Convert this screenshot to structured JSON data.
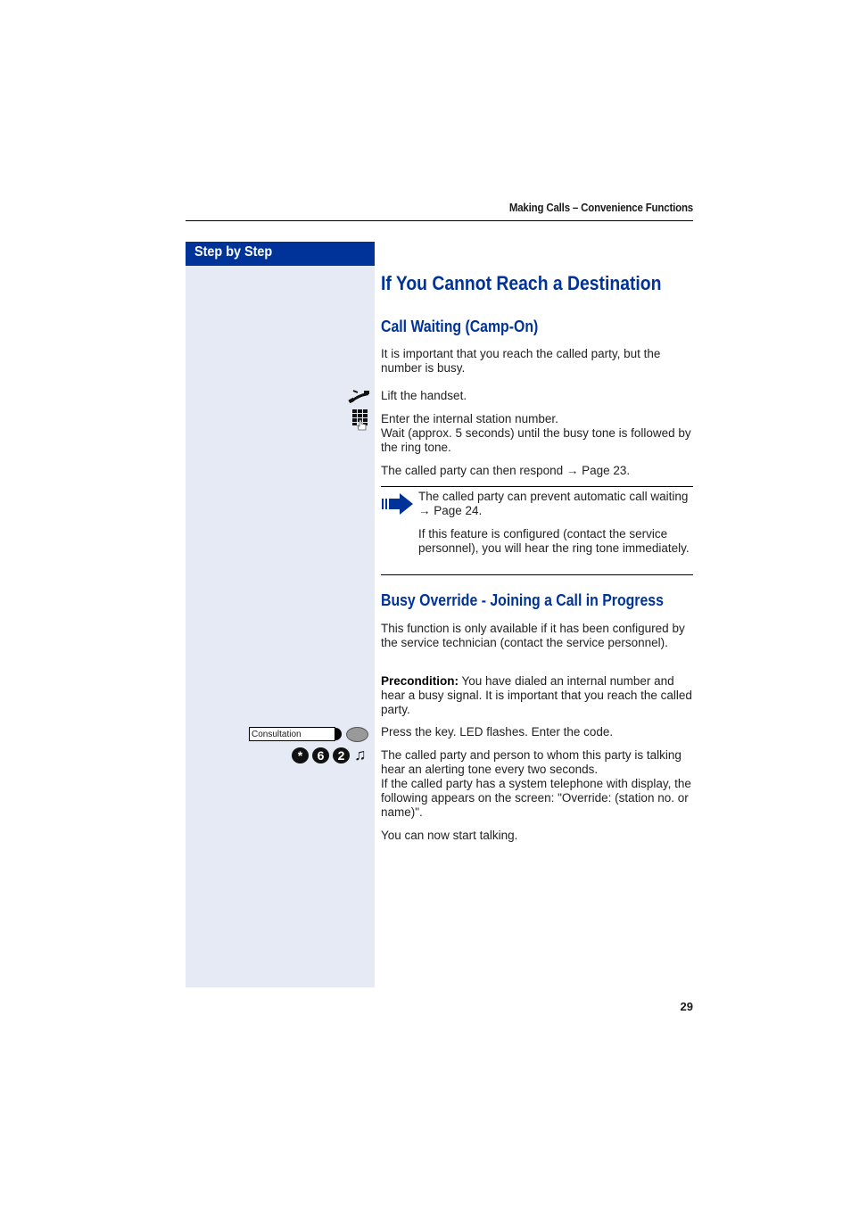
{
  "header": {
    "running_title": "Making Calls – Convenience Functions"
  },
  "sidebar": {
    "title": "Step by Step"
  },
  "main": {
    "title": "If You Cannot Reach a Destination",
    "section1": {
      "heading": "Call Waiting (Camp-On)",
      "intro": "It is important that you reach the called party, but the number is busy.",
      "step1": {
        "icon": "handset-lift-icon",
        "text": "Lift the handset."
      },
      "step2": {
        "icon": "keypad-icon",
        "text_line1": "Enter the internal station number.",
        "text_line2": "Wait (approx. 5 seconds) until the busy tone is followed by the ring tone."
      },
      "respond": "The called party can then respond → Page 23.",
      "note": {
        "icon": "note-arrow-icon",
        "text1": "The called party can prevent automatic call waiting → Page 24.",
        "text2": "If this feature is configured (contact the service personnel), you will hear the ring tone immediately."
      }
    },
    "section2": {
      "heading": "Busy Override - Joining a Call in Progress",
      "intro": "This function is only available if it has been configured by the service technician (contact the service personnel).",
      "precondition_label": "Precondition:",
      "precondition_text": " You have dialed an internal number and hear a busy signal. It is important that you reach the called party.",
      "step1": {
        "key_label": "Consultation",
        "text": "Press the key. LED flashes. Enter the code."
      },
      "step2": {
        "code_keys": [
          "*",
          "6",
          "2"
        ],
        "tone_icon": "♫",
        "text_line1": "The called party and person to whom this party is talking hear an alerting tone every two seconds.",
        "text_line2": "If the called party has a system telephone with display, the following appears on the screen: \"Override: (station no. or name)\"."
      },
      "closing": "You can now start talking."
    }
  },
  "footer": {
    "page_number": "29"
  },
  "colors": {
    "accent": "#003399",
    "sidebar_bg": "#e6eaf5"
  }
}
